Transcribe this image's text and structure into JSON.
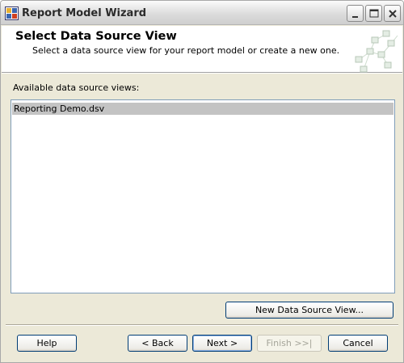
{
  "window": {
    "title": "Report Model Wizard",
    "icon": "wizard-app-icon"
  },
  "header": {
    "title": "Select Data Source View",
    "subtitle": "Select a data source view for your report model or create a new one.",
    "graphic": "network-graphic-icon"
  },
  "list": {
    "label": "Available data source views:",
    "items": [
      {
        "label": "Reporting Demo.dsv",
        "selected": true
      }
    ]
  },
  "buttons": {
    "new_dsv": "New Data Source View...",
    "help": "Help",
    "back": "< Back",
    "next": "Next >",
    "finish": "Finish >>|",
    "cancel": "Cancel"
  },
  "colors": {
    "selection": "#c3c3c3",
    "dialog_bg": "#ece9d8",
    "listbox_border": "#7f9db9"
  }
}
